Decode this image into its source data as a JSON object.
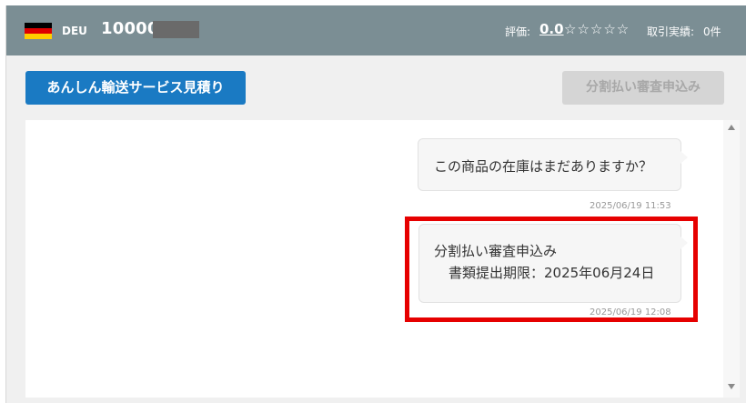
{
  "header": {
    "flag_icon": "germany-flag-icon",
    "flag_colors": [
      "#000000",
      "#dd0000",
      "#ffce00"
    ],
    "country_code": "DEU",
    "user_id": "10000",
    "rating_label": "評価:",
    "rating_value": "0.0",
    "stars": "☆☆☆☆☆",
    "transactions_label": "取引実績:",
    "transactions_count": "0件"
  },
  "buttons": {
    "shipping_estimate": "あんしん輸送サービス見積り",
    "installment_review": "分割払い審査申込み"
  },
  "messages": [
    {
      "text": "この商品の在庫はまだありますか？",
      "timestamp": "2025/06/19 11:53"
    },
    {
      "line1": "分割払い審査申込み",
      "line2": "書類提出期限：2025年06月24日",
      "timestamp": "2025/06/19 12:08"
    }
  ],
  "colors": {
    "header_bg": "#7b8e94",
    "primary_button": "#1a7ac3",
    "disabled_button": "#d5d5d5",
    "highlight_border": "#e60000"
  }
}
